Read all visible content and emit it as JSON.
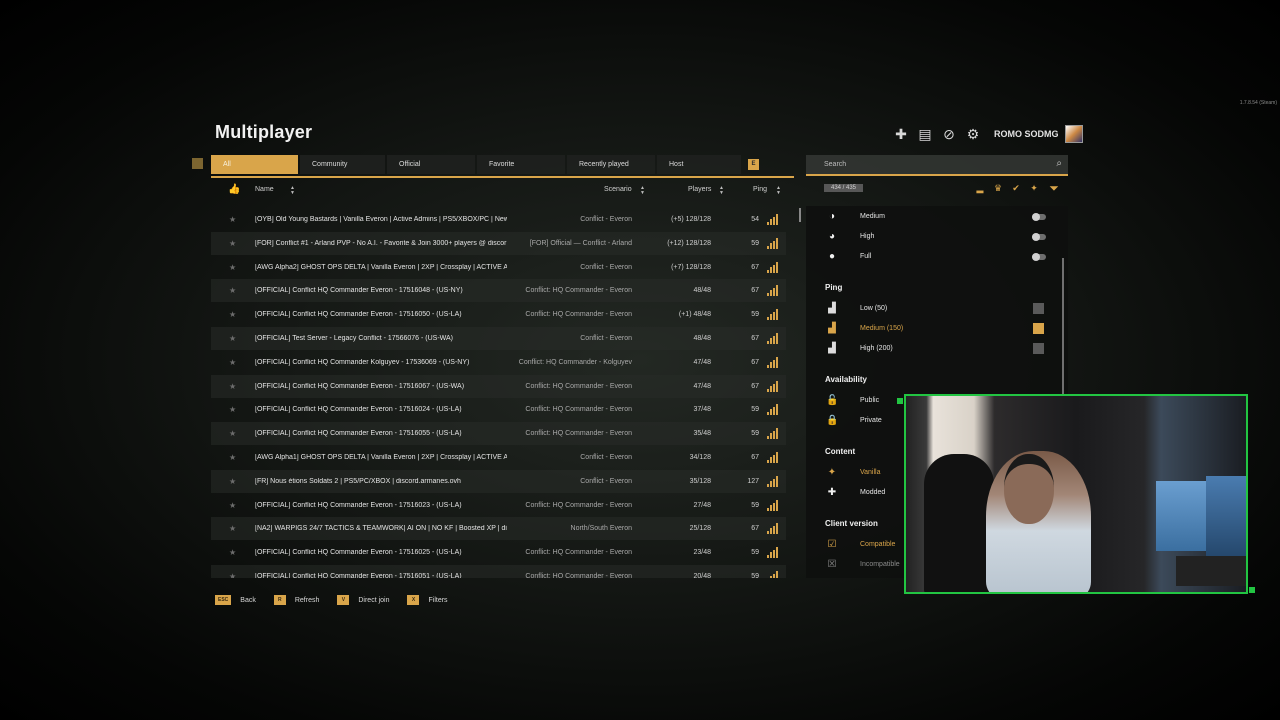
{
  "version": "1.7.8.54 (Steam)",
  "title": "Multiplayer",
  "user": {
    "name": "ROMO SODMG"
  },
  "top_icons": [
    "workshop-icon",
    "news-icon",
    "block-list-icon",
    "settings-gear-icon"
  ],
  "tabs": [
    {
      "label": "All",
      "active": true
    },
    {
      "label": "Community"
    },
    {
      "label": "Official"
    },
    {
      "label": "Favorite"
    },
    {
      "label": "Recently played"
    },
    {
      "label": "Host"
    }
  ],
  "tab_key": "E",
  "columns": {
    "name": "Name",
    "scenario": "Scenario",
    "players": "Players",
    "ping": "Ping"
  },
  "servers": [
    {
      "name": "[OYB] Old Young Bastards | Vanilla Everon | Active Admins | PS5/XBOX/PC | New",
      "scenario": "Conflict - Everon",
      "players": "(+5) 128/128",
      "ping": "54"
    },
    {
      "name": "[FOR] Conflict #1 - Arland PVP - No A.I. - Favorite & Join 3000+ players @ discor",
      "scenario": "[FOR] Official — Conflict - Arland",
      "players": "(+12) 128/128",
      "ping": "59"
    },
    {
      "name": "[AWG Alpha2] GHOST OPS DELTA | Vanilla Everon | 2XP | Crossplay | ACTIVE AD",
      "scenario": "Conflict - Everon",
      "players": "(+7) 128/128",
      "ping": "67"
    },
    {
      "name": "[OFFICIAL] Conflict HQ Commander Everon - 17516048 - (US-NY)",
      "scenario": "Conflict: HQ Commander - Everon",
      "players": "48/48",
      "ping": "67"
    },
    {
      "name": "[OFFICIAL] Conflict HQ Commander Everon - 17516050 - (US-LA)",
      "scenario": "Conflict: HQ Commander - Everon",
      "players": "(+1) 48/48",
      "ping": "59"
    },
    {
      "name": "[OFFICIAL] Test Server - Legacy Conflict - 17566076 - (US-WA)",
      "scenario": "Conflict - Everon",
      "players": "48/48",
      "ping": "67"
    },
    {
      "name": "[OFFICIAL] Conflict HQ Commander Kolguyev - 17536069 - (US-NY)",
      "scenario": "Conflict: HQ Commander - Kolguyev",
      "players": "47/48",
      "ping": "67"
    },
    {
      "name": "[OFFICIAL] Conflict HQ Commander Everon - 17516067 - (US-WA)",
      "scenario": "Conflict: HQ Commander - Everon",
      "players": "47/48",
      "ping": "67"
    },
    {
      "name": "[OFFICIAL] Conflict HQ Commander Everon - 17516024 - (US-LA)",
      "scenario": "Conflict: HQ Commander - Everon",
      "players": "37/48",
      "ping": "59"
    },
    {
      "name": "[OFFICIAL] Conflict HQ Commander Everon - 17516055 - (US-LA)",
      "scenario": "Conflict: HQ Commander - Everon",
      "players": "35/48",
      "ping": "59"
    },
    {
      "name": "[AWG Alpha1] GHOST OPS DELTA | Vanilla Everon | 2XP | Crossplay | ACTIVE AD",
      "scenario": "Conflict - Everon",
      "players": "34/128",
      "ping": "67"
    },
    {
      "name": "[FR] Nous étions Soldats 2 | PS5/PC/XBOX | discord.armanes.ovh",
      "scenario": "Conflict - Everon",
      "players": "35/128",
      "ping": "127"
    },
    {
      "name": "[OFFICIAL] Conflict HQ Commander Everon - 17516023 - (US-LA)",
      "scenario": "Conflict: HQ Commander - Everon",
      "players": "27/48",
      "ping": "59"
    },
    {
      "name": "[NA2] WARPIGS 24/7 TACTICS & TEAMWORK| AI ON | NO KF | Boosted XP | disc",
      "scenario": "North/South Everon",
      "players": "25/128",
      "ping": "67"
    },
    {
      "name": "[OFFICIAL] Conflict HQ Commander Everon - 17516025 - (US-LA)",
      "scenario": "Conflict: HQ Commander - Everon",
      "players": "23/48",
      "ping": "59"
    },
    {
      "name": "[OFFICIAL] Conflict HQ Commander Everon - 17516051 - (US-LA)",
      "scenario": "Conflict: HQ Commander - Everon",
      "players": "20/48",
      "ping": "59"
    }
  ],
  "bottom_actions": [
    {
      "key": "ESC",
      "label": "Back"
    },
    {
      "key": "R",
      "label": "Refresh"
    },
    {
      "key": "V",
      "label": "Direct join"
    },
    {
      "key": "X",
      "label": "Filters"
    }
  ],
  "search": {
    "placeholder": "Search"
  },
  "server_count": "434 / 435",
  "filters": {
    "fullness": [
      {
        "label": "Medium"
      },
      {
        "label": "High"
      },
      {
        "label": "Full"
      }
    ],
    "ping_title": "Ping",
    "ping": [
      {
        "label": "Low (50)",
        "checked": false
      },
      {
        "label": "Medium (150)",
        "checked": true
      },
      {
        "label": "High (200)",
        "checked": false
      }
    ],
    "availability_title": "Availability",
    "availability": [
      {
        "label": "Public"
      },
      {
        "label": "Private"
      }
    ],
    "content_title": "Content",
    "content": [
      {
        "label": "Vanilla"
      },
      {
        "label": "Modded"
      }
    ],
    "client_title": "Client version",
    "client": [
      {
        "label": "Compatible"
      },
      {
        "label": "Incompatible"
      }
    ]
  },
  "colors": {
    "accent": "#d9a54a",
    "webcam_border": "#22c542"
  }
}
